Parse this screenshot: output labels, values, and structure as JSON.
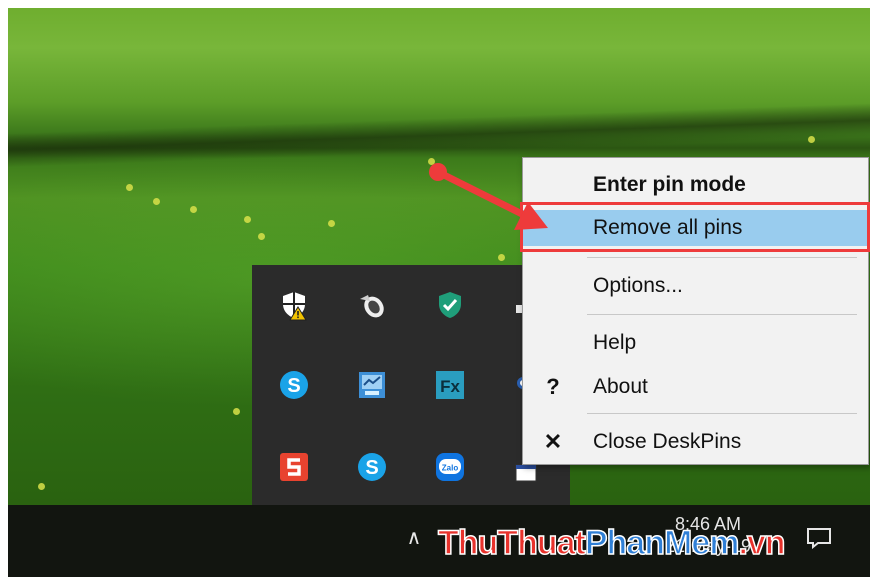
{
  "context_menu": {
    "items": [
      {
        "label": "Enter pin mode",
        "bold": true
      },
      {
        "label": "Remove all pins",
        "highlighted": true
      },
      {
        "label": "Options..."
      },
      {
        "label": "Help"
      },
      {
        "label": "About",
        "icon": "question-mark-icon",
        "glyph": "?"
      },
      {
        "label": "Close DeskPins",
        "icon": "close-icon",
        "glyph": "✕"
      }
    ]
  },
  "taskbar": {
    "time": "8:46 AM",
    "date": "21-May-19",
    "overflow_glyph": "∧"
  },
  "tray_icons": [
    "security-shield-warning-icon",
    "speaker-icon",
    "kaspersky-shield-icon",
    "skype-icon",
    "network-monitor-icon",
    "effects-fx-icon",
    "snagit-icon",
    "skype-icon",
    "zalo-icon",
    "deskpins-icon",
    "app-partial-icon"
  ],
  "tray_icon_text": {
    "skype": "S",
    "fx": "Fx",
    "zalo": "Zalo"
  },
  "watermark": {
    "part1": "ThuThuat",
    "part2": "PhanMem",
    "part3": ".vn"
  },
  "colors": {
    "highlight": "#99ccee",
    "annotation_red": "#ee3b3b"
  }
}
